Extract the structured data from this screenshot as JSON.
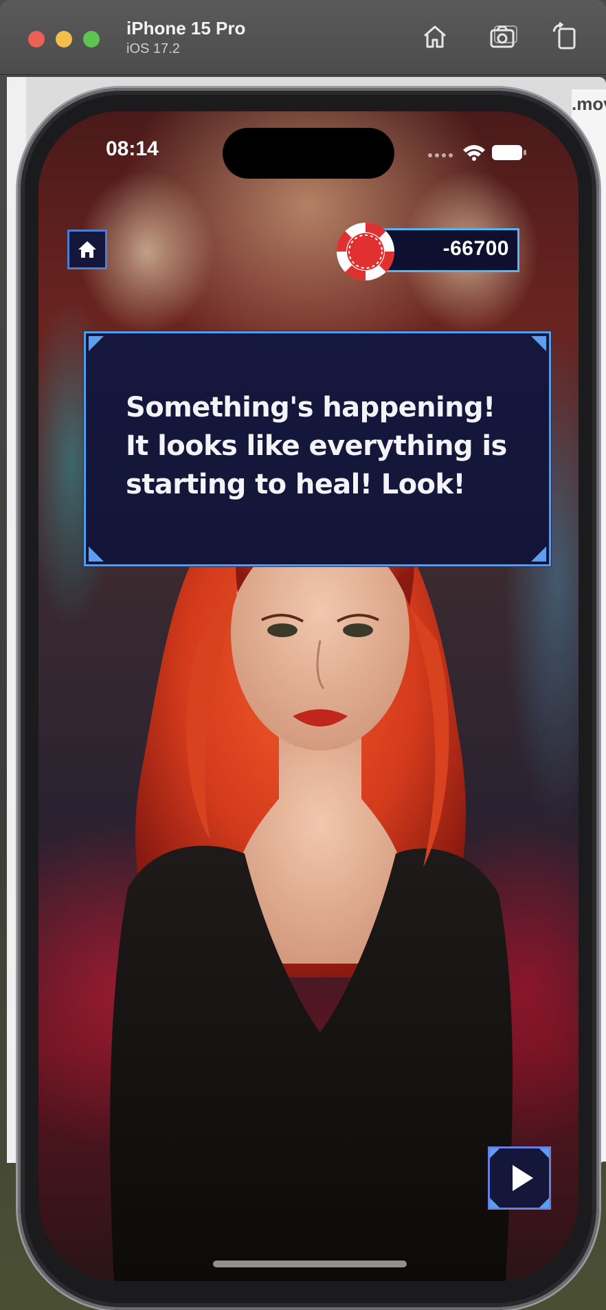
{
  "simulator": {
    "device_name": "iPhone 15 Pro",
    "os_version": "iOS 17.2",
    "toolbar_icons": [
      "home-icon",
      "screenshot-icon",
      "rotate-icon"
    ]
  },
  "background_window": {
    "partial_label": ".mov"
  },
  "status_bar": {
    "time": "08:14",
    "icons": [
      "signal-icon",
      "wifi-icon",
      "battery-icon"
    ]
  },
  "hud": {
    "balance": "-66700",
    "chip_icon": "poker-chip-icon",
    "home_icon": "home-icon"
  },
  "dialog": {
    "text": "Something's happening! It looks like everything is starting to heal! Look!"
  },
  "controls": {
    "next_icon": "play-icon"
  },
  "colors": {
    "panel_bg": "#14163a",
    "panel_border": "#4f9ff0",
    "chip_red": "#e03030",
    "accent": "#56b6f0"
  }
}
